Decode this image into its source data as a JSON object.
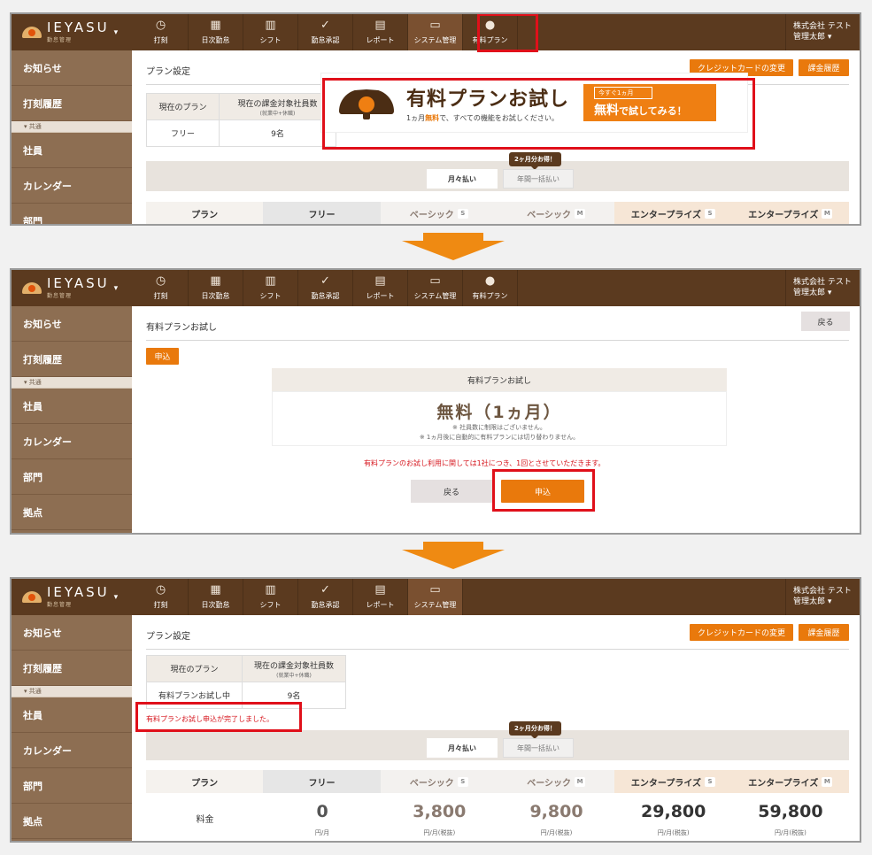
{
  "logo": {
    "text": "IEYASU",
    "sub": "勤怠管理",
    "caret": "▾"
  },
  "nav": [
    {
      "label": "打刻",
      "icon": "◷"
    },
    {
      "label": "日次勤怠",
      "icon": "▦"
    },
    {
      "label": "シフト",
      "icon": "▥"
    },
    {
      "label": "勤怠承認",
      "icon": "✓"
    },
    {
      "label": "レポート",
      "icon": "▤"
    },
    {
      "label": "システム管理",
      "icon": "▭"
    },
    {
      "label": "有料プラン",
      "icon": "●"
    }
  ],
  "company": {
    "name": "株式会社 テスト",
    "user": "管理太郎 ▾"
  },
  "sidebar": {
    "items_top": [
      "お知らせ",
      "打刻履歴"
    ],
    "group": "▾ 共通",
    "items_bottom": [
      "社員",
      "カレンダー",
      "部門",
      "拠点"
    ]
  },
  "screen1": {
    "title": "プラン設定",
    "btn_card": "クレジットカードの変更",
    "btn_history": "課金履歴",
    "table": {
      "col1": "現在のプラン",
      "col2": "現在の課金対象社員数",
      "col2_sub": "(就業中+休職)",
      "plan": "フリー",
      "count": "9名"
    },
    "banner": {
      "title": "有料プランお試し",
      "sub_pre": "1ヵ月",
      "sub_em": "無料",
      "sub_post": "で、すべての機能をお試しください。",
      "cta_top": "今すぐ1ヵ月",
      "cta_em": "無料",
      "cta_post": "で試してみる！"
    },
    "bubble": "2ヶ月分お得！",
    "tab_monthly": "月々払い",
    "tab_yearly": "年間一括払い",
    "plans": [
      "プラン",
      "フリー",
      "ベーシック",
      "ベーシック",
      "エンタープライズ",
      "エンタープライズ"
    ],
    "badges": [
      "",
      "",
      "S",
      "M",
      "S",
      "M"
    ]
  },
  "screen2": {
    "title": "有料プランお試し",
    "btn_back": "戻る",
    "btn_apply_small": "申込",
    "box_title": "有料プランお試し",
    "price": "無料（1ヵ月）",
    "note1": "※ 社員数に制限はございません。",
    "note2": "※ 1ヵ月後に自動的に有料プランには切り替わりません。",
    "notice": "有料プランのお試し利用に関しては1社につき、1回とさせていただきます。",
    "btn_back2": "戻る",
    "btn_apply": "申込"
  },
  "screen3": {
    "title": "プラン設定",
    "btn_card": "クレジットカードの変更",
    "btn_history": "課金履歴",
    "table": {
      "col1": "現在のプラン",
      "col2": "現在の課金対象社員数",
      "col2_sub": "(就業中+休職)",
      "plan": "有料プランお試し中",
      "count": "9名"
    },
    "complete": "有料プランお試し申込が完了しました。",
    "bubble": "2ヶ月分お得！",
    "tab_monthly": "月々払い",
    "tab_yearly": "年間一括払い",
    "plans": [
      "プラン",
      "フリー",
      "ベーシック",
      "ベーシック",
      "エンタープライズ",
      "エンタープライズ"
    ],
    "badges": [
      "",
      "",
      "S",
      "M",
      "S",
      "M"
    ],
    "price_label": "料金",
    "prices": [
      "0",
      "3,800",
      "9,800",
      "29,800",
      "59,800"
    ],
    "units": [
      "円/月",
      "円/月(税抜)",
      "円/月(税抜)",
      "円/月(税抜)",
      "円/月(税抜)"
    ]
  },
  "colors": {
    "topbar": "#5b3a1f",
    "accent": "#e9790c",
    "alert": "#e0101a",
    "sidebar": "#8d6e52"
  }
}
